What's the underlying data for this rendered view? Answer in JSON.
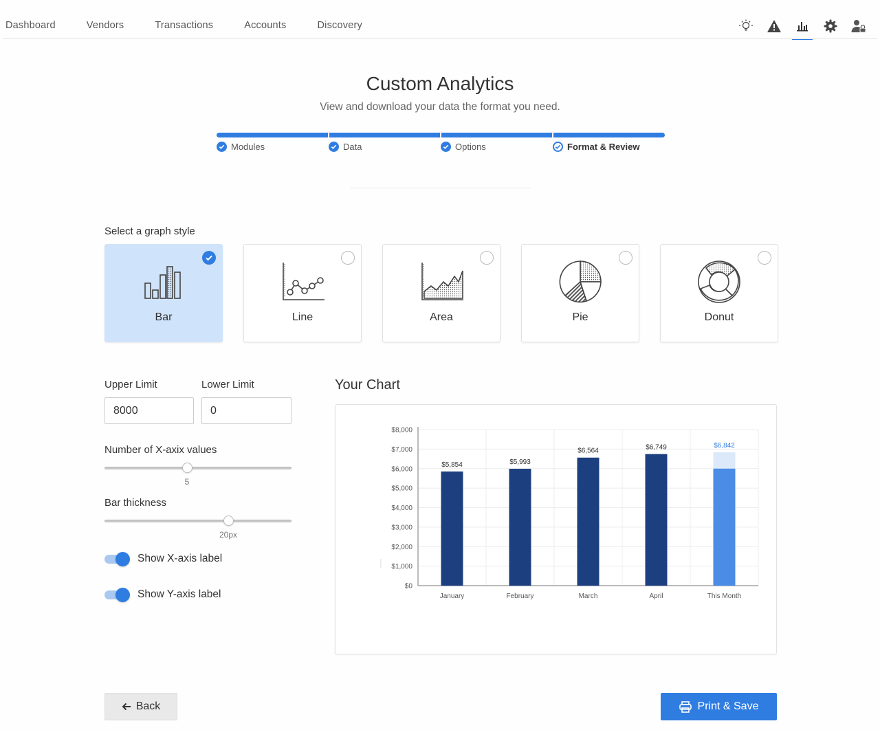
{
  "nav": {
    "links": [
      "Dashboard",
      "Vendors",
      "Transactions",
      "Accounts",
      "Discovery"
    ],
    "icons": [
      "lightbulb-icon",
      "warning-icon",
      "analytics-icon",
      "settings-gear-icon",
      "user-lock-icon"
    ],
    "active_icon": "analytics-icon"
  },
  "header": {
    "title": "Custom Analytics",
    "subtitle": "View and download your data the format you need."
  },
  "stepper": {
    "progress_percent": 100,
    "steps": [
      {
        "label": "Modules",
        "state": "complete"
      },
      {
        "label": "Data",
        "state": "complete"
      },
      {
        "label": "Options",
        "state": "complete"
      },
      {
        "label": "Format & Review",
        "state": "current"
      }
    ]
  },
  "graph_style": {
    "label": "Select a graph style",
    "options": [
      {
        "label": "Bar",
        "icon": "bar-chart-icon",
        "selected": true
      },
      {
        "label": "Line",
        "icon": "line-chart-icon",
        "selected": false
      },
      {
        "label": "Area",
        "icon": "area-chart-icon",
        "selected": false
      },
      {
        "label": "Pie",
        "icon": "pie-chart-icon",
        "selected": false
      },
      {
        "label": "Donut",
        "icon": "donut-chart-icon",
        "selected": false
      }
    ]
  },
  "controls": {
    "upper_limit_label": "Upper Limit",
    "upper_limit_value": "8000",
    "lower_limit_label": "Lower Limit",
    "lower_limit_value": "0",
    "x_values_label": "Number of X-axix values",
    "x_values_value": "5",
    "x_values_fraction": 0.44,
    "bar_thickness_label": "Bar thickness",
    "bar_thickness_value": "20px",
    "bar_thickness_fraction": 0.66,
    "show_x_label": "Show X-axis label",
    "show_x_on": true,
    "show_y_label": "Show Y-axis label",
    "show_y_on": true
  },
  "chart_section": {
    "title": "Your Chart"
  },
  "chart_data": {
    "type": "bar",
    "title": "Your Chart",
    "xlabel": "",
    "ylabel": "",
    "categories": [
      "January",
      "February",
      "March",
      "April",
      "This Month"
    ],
    "values": [
      5854,
      5993,
      6564,
      6749,
      6842
    ],
    "data_labels": [
      "$5,854",
      "$5,993",
      "$6,564",
      "$6,749",
      "$6,842"
    ],
    "this_month_solid_portion": 6000,
    "ylim": [
      0,
      8000
    ],
    "yticks": [
      0,
      1000,
      2000,
      3000,
      4000,
      5000,
      6000,
      7000,
      8000
    ],
    "ytick_labels": [
      "$0",
      "$1,000",
      "$2,000",
      "$3,000",
      "$4,000",
      "$5,000",
      "$6,000",
      "$7,000",
      "$8,000"
    ],
    "grid": true,
    "colors": {
      "bar": "#1c3f7f",
      "current_bar": "#4a8ce6",
      "current_bar_projected": "#dce9fa",
      "current_label": "#2f7de1",
      "label": "#333333"
    }
  },
  "buttons": {
    "back": "Back",
    "print_save": "Print & Save"
  }
}
